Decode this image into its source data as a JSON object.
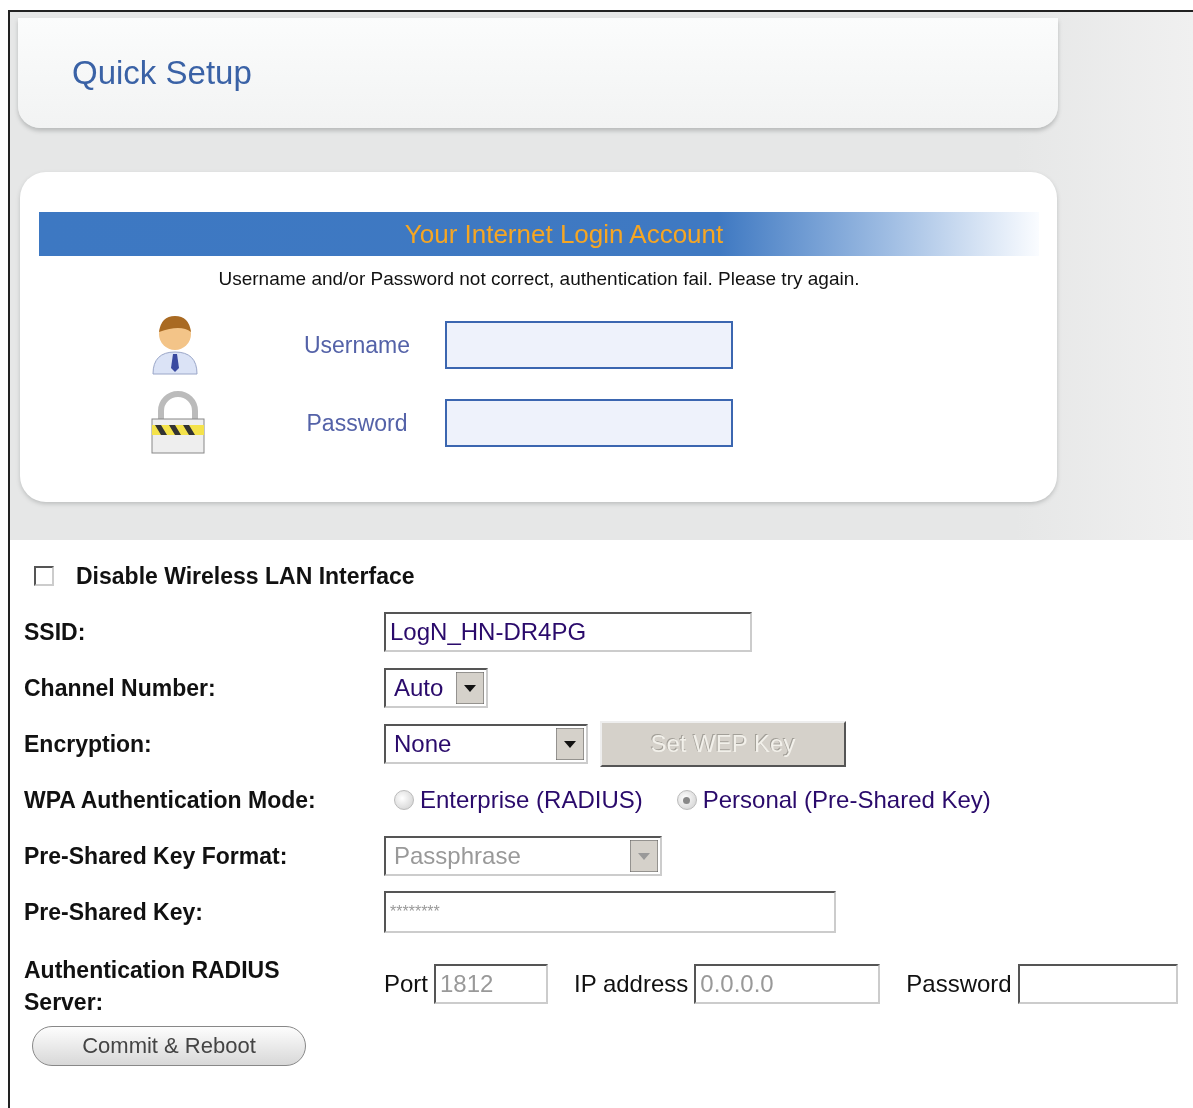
{
  "header": {
    "title": "Quick Setup"
  },
  "login": {
    "heading": "Your Internet Login Account",
    "message": "Username and/or Password not correct, authentication fail. Please try again.",
    "fields": [
      {
        "kind": "user",
        "label": "Username"
      },
      {
        "kind": "lock",
        "label": "Password"
      }
    ]
  },
  "wireless": {
    "disable_checkbox": {
      "label": "Disable Wireless LAN Interface",
      "checked": false
    },
    "ssid": {
      "label": "SSID:",
      "value": "LogN_HN-DR4PG"
    },
    "channel": {
      "label": "Channel Number:",
      "value": "Auto"
    },
    "encryption": {
      "label": "Encryption:",
      "value": "None",
      "button": {
        "label": "Set WEP Key",
        "disabled": true
      }
    },
    "wpa_mode": {
      "label": "WPA Authentication Mode:",
      "options": [
        {
          "label": "Enterprise (RADIUS)",
          "selected": false
        },
        {
          "label": "Personal (Pre-Shared Key)",
          "selected": true
        }
      ]
    },
    "psk_format": {
      "label": "Pre-Shared Key Format:",
      "value": "Passphrase",
      "disabled": true
    },
    "psk": {
      "label": "Pre-Shared Key:",
      "value": "********",
      "disabled": true
    },
    "radius": {
      "label": "Authentication RADIUS Server:",
      "fields": [
        {
          "label": "Port",
          "value": "1812",
          "disabled": true
        },
        {
          "label": "IP address",
          "value": "0.0.0.0",
          "disabled": true
        },
        {
          "label": "Password"
        }
      ]
    }
  },
  "commit_button": "Commit & Reboot"
}
